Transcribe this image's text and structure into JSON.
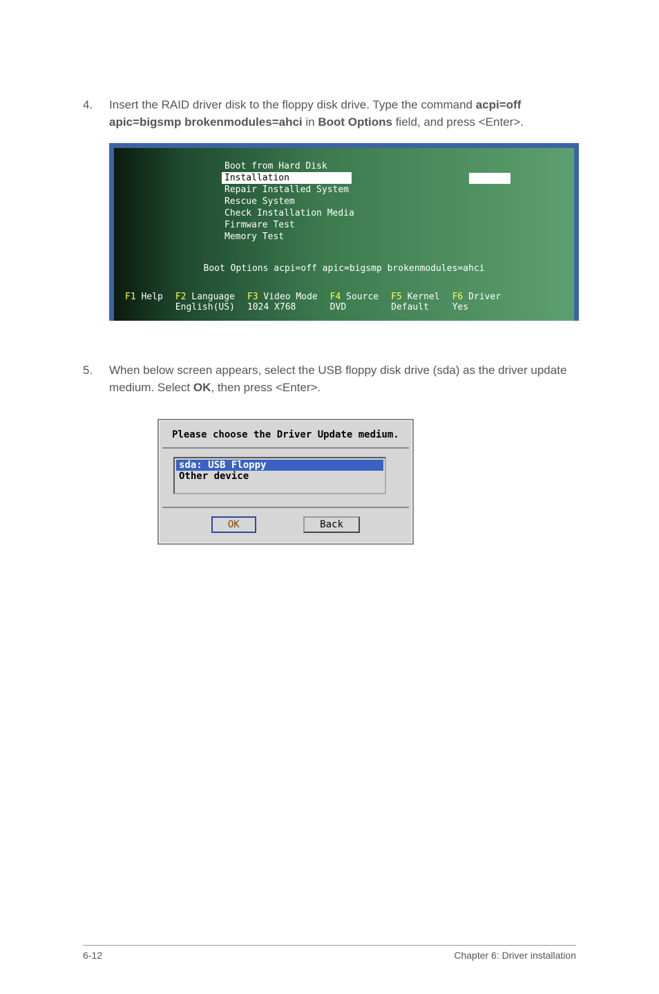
{
  "step4": {
    "num": "4.",
    "pre": "Insert the RAID driver disk to the floppy disk drive. Type the command ",
    "cmd": "acpi=off apic=bigsmp brokenmodules=ahci",
    "mid": " in ",
    "field": "Boot Options",
    "post": " field, and press <Enter>."
  },
  "boot_menu": {
    "items": [
      "Boot from Hard Disk",
      "Installation",
      "Repair Installed System",
      "Rescue System",
      "Check Installation Media",
      "Firmware Test",
      "Memory Test"
    ],
    "selected_index": 1,
    "boot_options_line": "Boot Options acpi=off apic=bigsmp brokenmodules=ahci",
    "fkeys": [
      {
        "key": "F1",
        "label": "Help",
        "sub": ""
      },
      {
        "key": "F2",
        "label": "Language",
        "sub": "English(US)"
      },
      {
        "key": "F3",
        "label": "Video Mode",
        "sub": "1024 X768"
      },
      {
        "key": "F4",
        "label": "Source",
        "sub": "DVD"
      },
      {
        "key": "F5",
        "label": "Kernel",
        "sub": "Default"
      },
      {
        "key": "F6",
        "label": "Driver",
        "sub": "Yes"
      }
    ]
  },
  "step5": {
    "num": "5.",
    "pre": "When below screen appears, select the USB floppy disk drive (sda) as the driver update medium. Select ",
    "ok": "OK",
    "post": ", then press <Enter>."
  },
  "dialog": {
    "title": "Please choose the Driver Update medium.",
    "items": [
      "sda: USB Floppy",
      "Other device"
    ],
    "selected_index": 0,
    "ok": "OK",
    "back": "Back"
  },
  "footer": {
    "left": "6-12",
    "right": "Chapter 6: Driver installation"
  }
}
